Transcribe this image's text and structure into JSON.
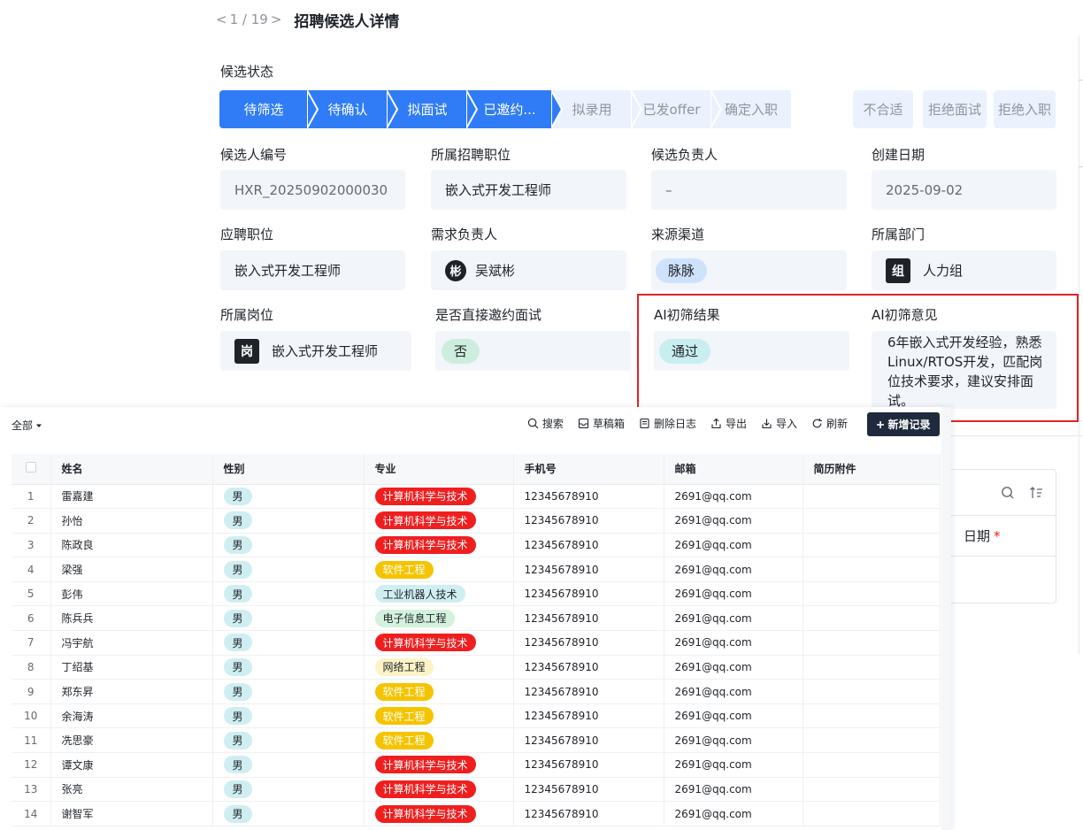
{
  "header": {
    "prev": "<",
    "pager": "1 / 19",
    "next": ">",
    "title": "招聘候选人详情"
  },
  "status": {
    "label": "候选状态",
    "stages": [
      "待筛选",
      "待确认",
      "拟面试",
      "已邀约...",
      "拟录用",
      "已发offer",
      "确定入职"
    ],
    "extra": [
      "不合适",
      "拒绝面试",
      "拒绝入职"
    ]
  },
  "fields": {
    "candidate_no": {
      "label": "候选人编号",
      "value": "HXR_20250902000030"
    },
    "position": {
      "label": "所属招聘职位",
      "value": "嵌入式开发工程师"
    },
    "owner": {
      "label": "候选负责人",
      "value": "–"
    },
    "created": {
      "label": "创建日期",
      "value": "2025-09-02"
    },
    "applied": {
      "label": "应聘职位",
      "value": "嵌入式开发工程师"
    },
    "demand_owner": {
      "label": "需求负责人",
      "avatar": "彬",
      "value": "吴斌彬"
    },
    "channel": {
      "label": "来源渠道",
      "value": "脉脉"
    },
    "dept": {
      "label": "所属部门",
      "avatar": "组",
      "value": "人力组"
    },
    "post": {
      "label": "所属岗位",
      "avatar": "岗",
      "value": "嵌入式开发工程师"
    },
    "direct": {
      "label": "是否直接邀约面试",
      "value": "否"
    },
    "ai_result": {
      "label": "AI初筛结果",
      "value": "通过"
    },
    "ai_opinion": {
      "label": "AI初筛意见",
      "value": "6年嵌入式开发经验，熟悉Linux/RTOS开发，匹配岗位技术要求，建议安排面试。"
    }
  },
  "bg_card": {
    "date_label": "日期",
    "required": "*"
  },
  "list": {
    "filter": "全部",
    "tools": [
      "搜索",
      "草稿箱",
      "删除日志",
      "导出",
      "导入",
      "刷新"
    ],
    "new_button": "新增记录",
    "columns": [
      "姓名",
      "性别",
      "专业",
      "手机号",
      "邮箱",
      "简历附件"
    ],
    "rows": [
      {
        "no": "1",
        "name": "雷嘉建",
        "gender": "男",
        "major": "计算机科学与技术",
        "major_color": "#f01f1f",
        "phone": "12345678910",
        "email": "2691@qq.com"
      },
      {
        "no": "2",
        "name": "孙怡",
        "gender": "男",
        "major": "计算机科学与技术",
        "major_color": "#f01f1f",
        "phone": "12345678910",
        "email": "2691@qq.com"
      },
      {
        "no": "3",
        "name": "陈政良",
        "gender": "男",
        "major": "计算机科学与技术",
        "major_color": "#f01f1f",
        "phone": "12345678910",
        "email": "2691@qq.com"
      },
      {
        "no": "4",
        "name": "梁强",
        "gender": "男",
        "major": "软件工程",
        "major_color": "#f5c400",
        "phone": "12345678910",
        "email": "2691@qq.com"
      },
      {
        "no": "5",
        "name": "彭伟",
        "gender": "男",
        "major": "工业机器人技术",
        "major_color": "#cfeef2",
        "phone": "12345678910",
        "email": "2691@qq.com"
      },
      {
        "no": "6",
        "name": "陈兵兵",
        "gender": "男",
        "major": "电子信息工程",
        "major_color": "#d3f1dc",
        "phone": "12345678910",
        "email": "2691@qq.com"
      },
      {
        "no": "7",
        "name": "冯宇航",
        "gender": "男",
        "major": "计算机科学与技术",
        "major_color": "#f01f1f",
        "phone": "12345678910",
        "email": "2691@qq.com"
      },
      {
        "no": "8",
        "name": "丁绍基",
        "gender": "男",
        "major": "网络工程",
        "major_color": "#fdf3c7",
        "phone": "12345678910",
        "email": "2691@qq.com"
      },
      {
        "no": "9",
        "name": "郑东昇",
        "gender": "男",
        "major": "软件工程",
        "major_color": "#f5c400",
        "phone": "12345678910",
        "email": "2691@qq.com"
      },
      {
        "no": "10",
        "name": "余海涛",
        "gender": "男",
        "major": "软件工程",
        "major_color": "#f5c400",
        "phone": "12345678910",
        "email": "2691@qq.com"
      },
      {
        "no": "11",
        "name": "冼思豪",
        "gender": "男",
        "major": "软件工程",
        "major_color": "#f5c400",
        "phone": "12345678910",
        "email": "2691@qq.com"
      },
      {
        "no": "12",
        "name": "谭文康",
        "gender": "男",
        "major": "计算机科学与技术",
        "major_color": "#f01f1f",
        "phone": "12345678910",
        "email": "2691@qq.com"
      },
      {
        "no": "13",
        "name": "张亮",
        "gender": "男",
        "major": "计算机科学与技术",
        "major_color": "#f01f1f",
        "phone": "12345678910",
        "email": "2691@qq.com"
      },
      {
        "no": "14",
        "name": "谢智军",
        "gender": "男",
        "major": "计算机科学与技术",
        "major_color": "#f01f1f",
        "phone": "12345678910",
        "email": "2691@qq.com"
      }
    ]
  }
}
